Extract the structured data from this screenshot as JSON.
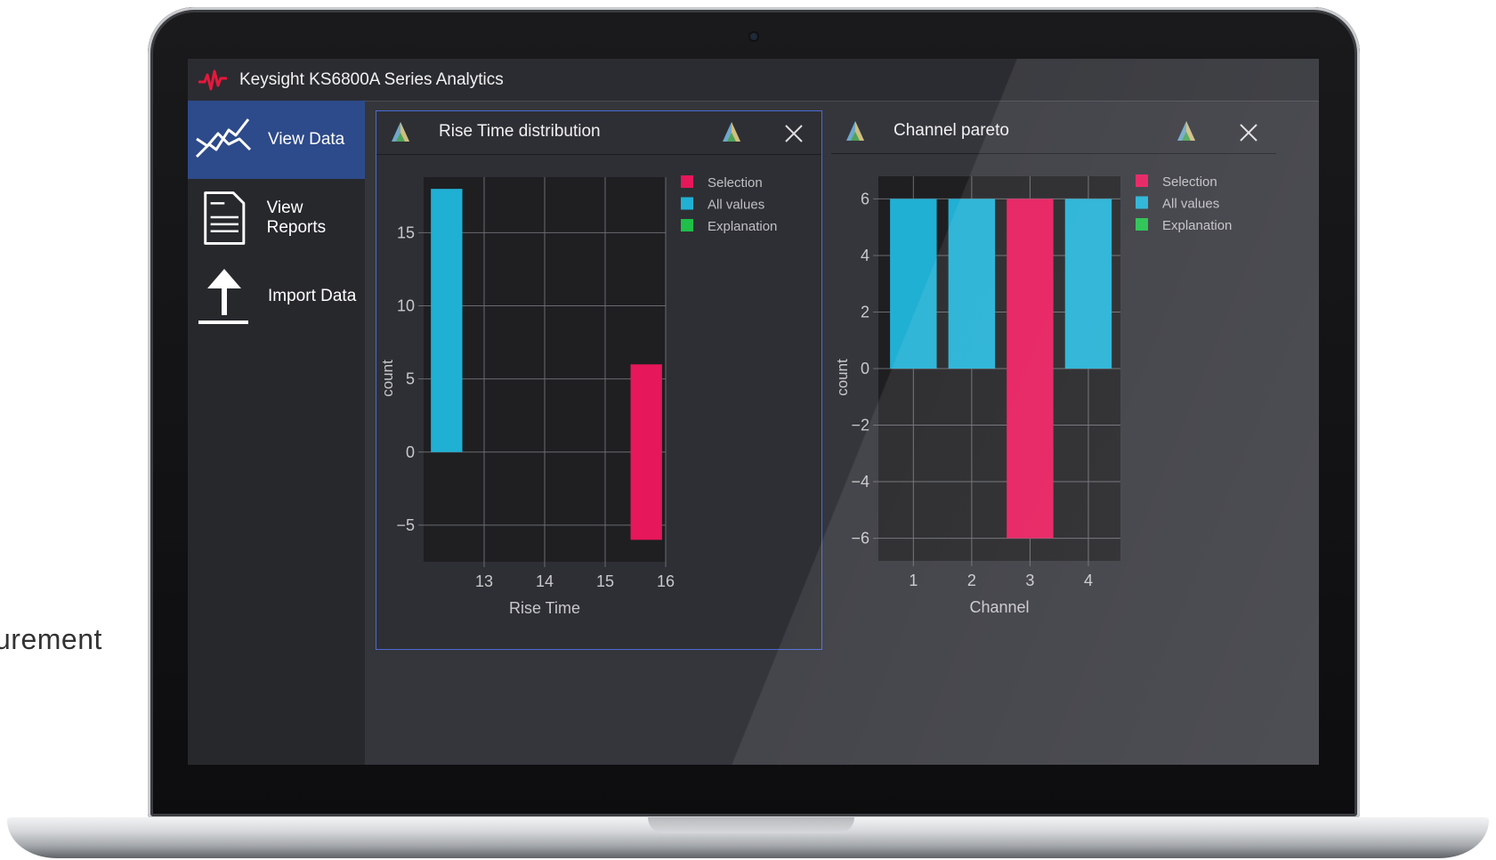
{
  "side_caption": "urement",
  "app": {
    "title": "Keysight KS6800A Series Analytics"
  },
  "sidebar": {
    "items": [
      {
        "label": "View Data",
        "icon": "line-chart-icon",
        "active": true
      },
      {
        "label": "View Reports",
        "icon": "document-icon",
        "active": false
      },
      {
        "label": "Import Data",
        "icon": "upload-icon",
        "active": false
      }
    ]
  },
  "colors": {
    "selection": "#e6175a",
    "all_values": "#20b0d4",
    "explanation": "#1fbf4a",
    "active_nav": "#2d4a8a",
    "panel_border": "#4a6bd1",
    "logo": "#e8173b"
  },
  "panels": [
    {
      "title": "Rise Time distribution",
      "close_icon": "close-icon",
      "header_icon": "triangle-icon"
    },
    {
      "title": "Channel pareto",
      "close_icon": "close-icon",
      "header_icon": "triangle-icon"
    }
  ],
  "chart_data": [
    {
      "type": "bar",
      "xlabel": "Rise Time",
      "ylabel": "count",
      "xlim": [
        12.0,
        16.0
      ],
      "ylim": [
        -7.5,
        18.8
      ],
      "xticks": [
        13,
        14,
        15,
        16
      ],
      "yticks": [
        -5,
        0,
        5,
        10,
        15
      ],
      "grid": true,
      "legend_position": "right",
      "legend": [
        "Selection",
        "All values",
        "Explanation"
      ],
      "bars": [
        {
          "series": "All values",
          "x0": 12.12,
          "x1": 12.64,
          "y0": 0,
          "y1": 18
        },
        {
          "series": "Selection",
          "x0": 15.42,
          "x1": 15.94,
          "y0": -6,
          "y1": 6
        }
      ]
    },
    {
      "type": "bar",
      "xlabel": "Channel",
      "ylabel": "count",
      "xlim": [
        0.4,
        4.55
      ],
      "ylim": [
        -6.8,
        6.8
      ],
      "xticks": [
        1,
        2,
        3,
        4
      ],
      "yticks": [
        -6,
        -4,
        -2,
        0,
        2,
        4,
        6
      ],
      "grid": true,
      "legend_position": "right",
      "legend": [
        "Selection",
        "All values",
        "Explanation"
      ],
      "bars": [
        {
          "series": "All values",
          "x0": 0.6,
          "x1": 1.4,
          "y0": 0,
          "y1": 6
        },
        {
          "series": "All values",
          "x0": 1.6,
          "x1": 2.4,
          "y0": 0,
          "y1": 6
        },
        {
          "series": "Selection",
          "x0": 2.6,
          "x1": 3.4,
          "y0": -6,
          "y1": 6
        },
        {
          "series": "All values",
          "x0": 3.6,
          "x1": 4.4,
          "y0": 0,
          "y1": 6
        }
      ]
    }
  ]
}
